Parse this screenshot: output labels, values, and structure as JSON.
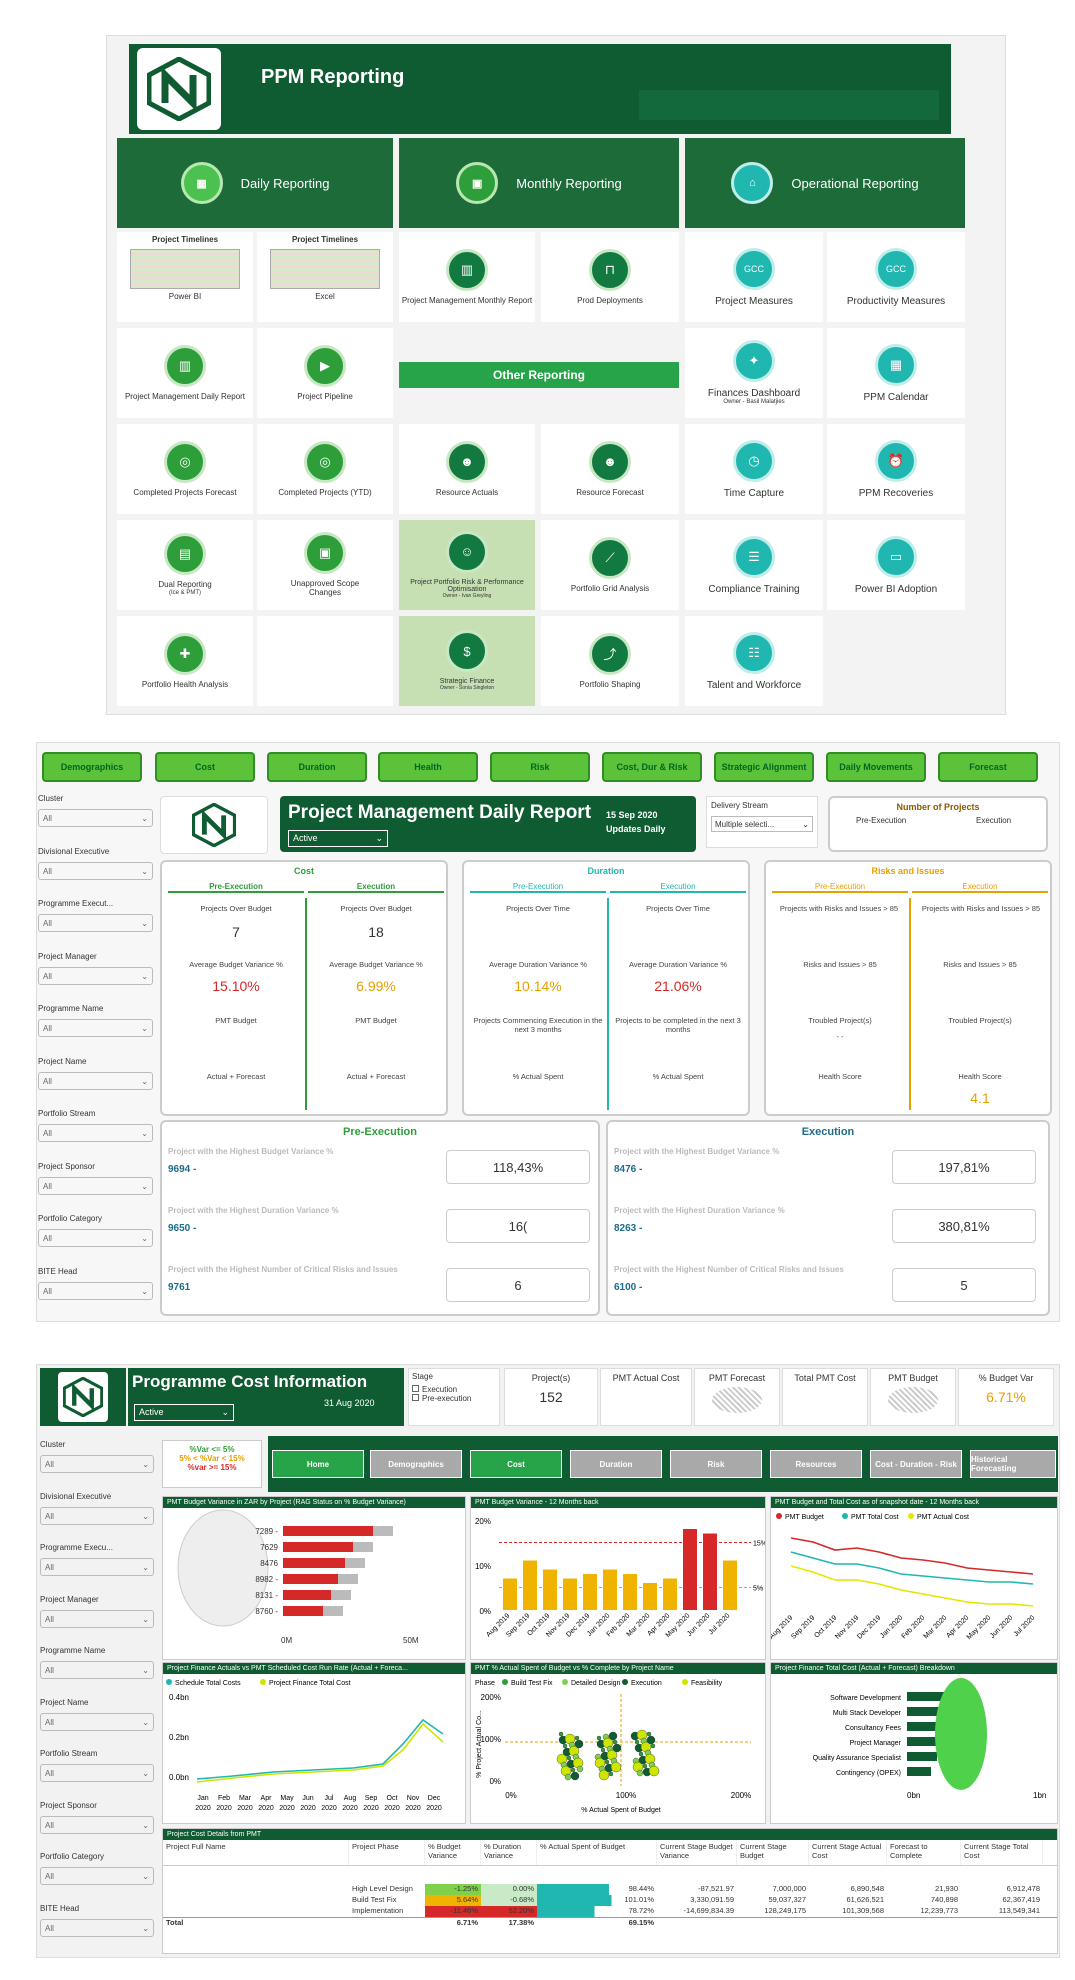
{
  "portal": {
    "title": "PPM Reporting",
    "sections": {
      "daily": "Daily Reporting",
      "monthly": "Monthly Reporting",
      "operational": "Operational Reporting",
      "other": "Other Reporting"
    },
    "timelines": [
      {
        "title": "Project Timelines",
        "label": "Power BI"
      },
      {
        "title": "Project Timelines",
        "label": "Excel"
      }
    ],
    "tiles": {
      "pm_monthly": "Project Management Monthly Report",
      "prod_deploy": "Prod Deployments",
      "proj_measures": "Project Measures",
      "prod_measures": "Productivity Measures",
      "gcc": "GCC",
      "pm_daily": "Project Management Daily Report",
      "pipeline": "Project Pipeline",
      "finances": "Finances Dashboard",
      "finances_owner": "Owner - Basil Malatjies",
      "calendar": "PPM Calendar",
      "cpf": "Completed Projects Forecast",
      "cp_ytd": "Completed Projects (YTD)",
      "res_actuals": "Resource Actuals",
      "res_forecast": "Resource Forecast",
      "time_capture": "Time Capture",
      "recoveries": "PPM Recoveries",
      "dual": "Dual Reporting",
      "dual_sub": "(Ice & PMT)",
      "unapproved": "Unapproved Scope Changes",
      "risk_perf": "Project Portfolio Risk & Performance Optimisation",
      "risk_perf_owner": "Owner - Ivan Greyling",
      "grid": "Portfolio Grid Analysis",
      "compliance": "Compliance Training",
      "adoption": "Power BI Adoption",
      "health": "Portfolio Health Analysis",
      "strat_fin": "Strategic Finance",
      "strat_fin_owner": "Owner - Sonia Singleton",
      "shaping": "Portfolio Shaping",
      "talent": "Talent and Workforce"
    }
  },
  "daily": {
    "nav": [
      "Demographics",
      "Cost",
      "Duration",
      "Health",
      "Risk",
      "Cost, Dur & Risk",
      "Strategic Alignment",
      "Daily Movements",
      "Forecast"
    ],
    "filters": [
      "Cluster",
      "Divisional Executive",
      "Programme Execut...",
      "Project Manager",
      "Programme Name",
      "Project Name",
      "Portfolio Stream",
      "Project Sponsor",
      "Portfolio Category",
      "BITE Head"
    ],
    "filter_value": "All",
    "title": "Project Management Daily Report",
    "date": "15 Sep 2020",
    "updates": "Updates Daily",
    "status": "Active",
    "delivery_label": "Delivery Stream",
    "delivery_value": "Multiple selecti...",
    "numproj": {
      "title": "Number of Projects",
      "pre": "Pre-Execution",
      "exe": "Execution"
    },
    "cost": {
      "title": "Cost",
      "pre": "Pre-Execution",
      "exe": "Execution",
      "l1": "Projects Over Budget",
      "v1a": "7",
      "v1b": "18",
      "l2": "Average Budget Variance %",
      "v2a": "15.10%",
      "v2b": "6.99%",
      "l3": "PMT Budget",
      "l4": "Actual + Forecast"
    },
    "duration": {
      "title": "Duration",
      "pre": "Pre-Execution",
      "exe": "Execution",
      "l1": "Projects Over Time",
      "l2": "Average Duration Variance %",
      "v2a": "10.14%",
      "v2b": "21.06%",
      "l3a": "Projects Commencing Execution in the next 3 months",
      "l3b": "Projects to be completed in the next 3 months",
      "l4": "% Actual Spent"
    },
    "risk": {
      "title": "Risks and Issues",
      "pre": "Pre-Execution",
      "exe": "Execution",
      "l1": "Projects with Risks and Issues > 85",
      "l2": "Risks and Issues > 85",
      "l3": "Troubled Project(s)",
      "l4": "Health Score",
      "v4b": "4.1",
      "v3a": "- -"
    },
    "pre_exec": {
      "title": "Pre-Execution",
      "r": [
        {
          "label": "Project with the Highest Budget Variance %",
          "id": "9694 -",
          "val": "118,43%"
        },
        {
          "label": "Project with the Highest Duration Variance %",
          "id": "9650 -",
          "val": "16("
        },
        {
          "label": "Project with the Highest Number of Critical Risks and Issues",
          "id": "9761",
          "val": "6"
        }
      ]
    },
    "exec": {
      "title": "Execution",
      "r": [
        {
          "label": "Project with the Highest Budget Variance %",
          "id": "8476 -",
          "val": "197,81%"
        },
        {
          "label": "Project with the Highest Duration Variance %",
          "id": "8263 -",
          "val": "380,81%"
        },
        {
          "label": "Project with the Highest Number of Critical Risks and Issues",
          "id": "6100 -",
          "val": "5"
        }
      ]
    }
  },
  "prog": {
    "title": "Programme Cost Information",
    "date": "31 Aug 2020",
    "status": "Active",
    "stage_label": "Stage",
    "stage_opts": [
      "Execution",
      "Pre-execution"
    ],
    "kpi": {
      "projects_label": "Project(s)",
      "projects": "152",
      "actual": "PMT Actual Cost",
      "forecast": "PMT Forecast",
      "total": "Total PMT Cost",
      "budget": "PMT Budget",
      "var_label": "% Budget Var",
      "var": "6.71%"
    },
    "legend": [
      "%Var <= 5%",
      "5% < %Var < 15%",
      "%var >= 15%"
    ],
    "nav": [
      "Home",
      "Demographics",
      "Cost",
      "Duration",
      "Risk",
      "Resources",
      "Cost - Duration - Risk",
      "Historical Forecasting"
    ],
    "filters": [
      "Cluster",
      "Divisional Executive",
      "Programme Execu...",
      "Project Manager",
      "Programme Name",
      "Project Name",
      "Portfolio Stream",
      "Project Sponsor",
      "Portfolio Category",
      "BITE Head"
    ],
    "filter_value": "All",
    "c1": {
      "title": "PMT Budget Variance in ZAR by Project (RAG Status on % Budget Variance)",
      "cats": [
        "7289 -",
        "7629",
        "8476",
        "8982 -",
        "8131 -",
        "8760 -"
      ],
      "ticks": [
        "0M",
        "50M"
      ]
    },
    "c2": {
      "title": "PMT Budget Variance - 12 Months back",
      "yt": [
        "20%",
        "10%",
        "0%"
      ],
      "lines": [
        "15%",
        "5%"
      ],
      "months": [
        "Aug 2019",
        "Sep 2019",
        "Oct 2019",
        "Nov 2019",
        "Dec 2019",
        "Jan 2020",
        "Feb 2020",
        "Mar 2020",
        "Apr 2020",
        "May 2020",
        "Jun 2020",
        "Jul 2020"
      ]
    },
    "c3": {
      "title": "PMT Budget and Total Cost as of snapshot date - 12 Months back",
      "legend": [
        "PMT Budget",
        "PMT Total Cost",
        "PMT Actual Cost"
      ]
    },
    "c4": {
      "title": "Project Finance Actuals vs PMT Scheduled Cost Run Rate (Actual + Foreca...",
      "legend": [
        "Schedule Total Costs",
        "Project Finance Total Cost"
      ],
      "yt": [
        "0.4bn",
        "0.2bn",
        "0.0bn"
      ],
      "months": [
        "Jan",
        "Feb",
        "Mar",
        "Apr",
        "May",
        "Jun",
        "Jul",
        "Aug",
        "Sep",
        "Oct",
        "Nov",
        "Dec"
      ],
      "year": "2020"
    },
    "c5": {
      "title": "PMT % Actual Spent of Budget vs % Complete by Project Name",
      "legend_label": "Phase",
      "legend": [
        "Build Test Fix",
        "Detailed Design",
        "Execution",
        "Feasibility"
      ],
      "yt": [
        "200%",
        "100%",
        "0%"
      ],
      "xt": [
        "0%",
        "100%",
        "200%"
      ],
      "xlabel": "% Actual Spent of Budget",
      "ylabel": "% Project Actual Co..."
    },
    "c6": {
      "title": "Project Finance Total Cost (Actual + Forecast) Breakdown",
      "cats": [
        "Software Development",
        "Multi Stack Developer",
        "Consultancy Fees",
        "Project Manager",
        "Quality Assurance Specialist",
        "Contingency (OPEX)"
      ],
      "ticks": [
        "0bn",
        "1bn"
      ]
    },
    "table": {
      "title": "Project Cost Details from PMT",
      "headers": [
        "Project Full Name",
        "Project Phase",
        "% Budget Variance",
        "% Duration Variance",
        "% Actual Spent of Budget",
        "Current Stage Budget Variance",
        "Current Stage Budget",
        "Current Stage Actual Cost",
        "Forecast to Complete",
        "Current Stage Total Cost"
      ],
      "rows": [
        [
          "",
          "High Level Design",
          "-1.25%",
          "0.00%",
          "98.44%",
          "-87,521.97",
          "7,000,000",
          "6,890,548",
          "21,930",
          "6,912,478"
        ],
        [
          "",
          "Build Test Fix",
          "5.64%",
          "-0.68%",
          "101.01%",
          "3,330,091.59",
          "59,037,327",
          "61,626,521",
          "740,898",
          "62,367,419"
        ],
        [
          "",
          "Implementation",
          "-11.46%",
          "52.20%",
          "78.72%",
          "-14,699,834.39",
          "128,249,175",
          "101,309,568",
          "12,239,773",
          "113,549,341"
        ]
      ],
      "total": [
        "Total",
        "",
        "6.71%",
        "17.38%",
        "69.15%",
        "",
        "",
        "",
        "",
        ""
      ]
    }
  }
}
